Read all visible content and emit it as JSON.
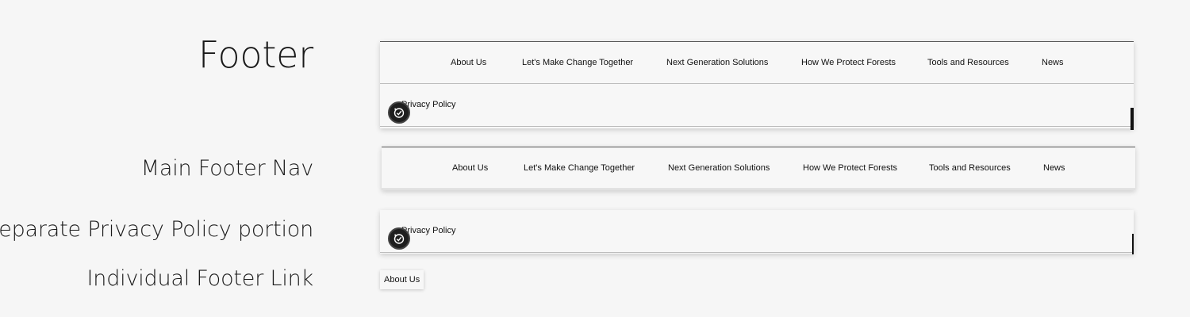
{
  "labels": {
    "footer": "Footer",
    "main_nav": "Main Footer Nav",
    "privacy_portion": "Separate Privacy Policy portion",
    "individual_link": "Individual Footer Link"
  },
  "nav": {
    "items": [
      "About Us",
      "Let's Make Change Together",
      "Next Generation Solutions",
      "How We Protect Forests",
      "Tools and Resources",
      "News"
    ]
  },
  "privacy": {
    "label": "Privacy Policy"
  },
  "individual": {
    "label": "About Us"
  },
  "icons": {
    "badge": "privacy-settings-icon"
  },
  "colors": {
    "background": "#f6f6f6",
    "badge": "#1e1e1e",
    "text": "#111111"
  }
}
